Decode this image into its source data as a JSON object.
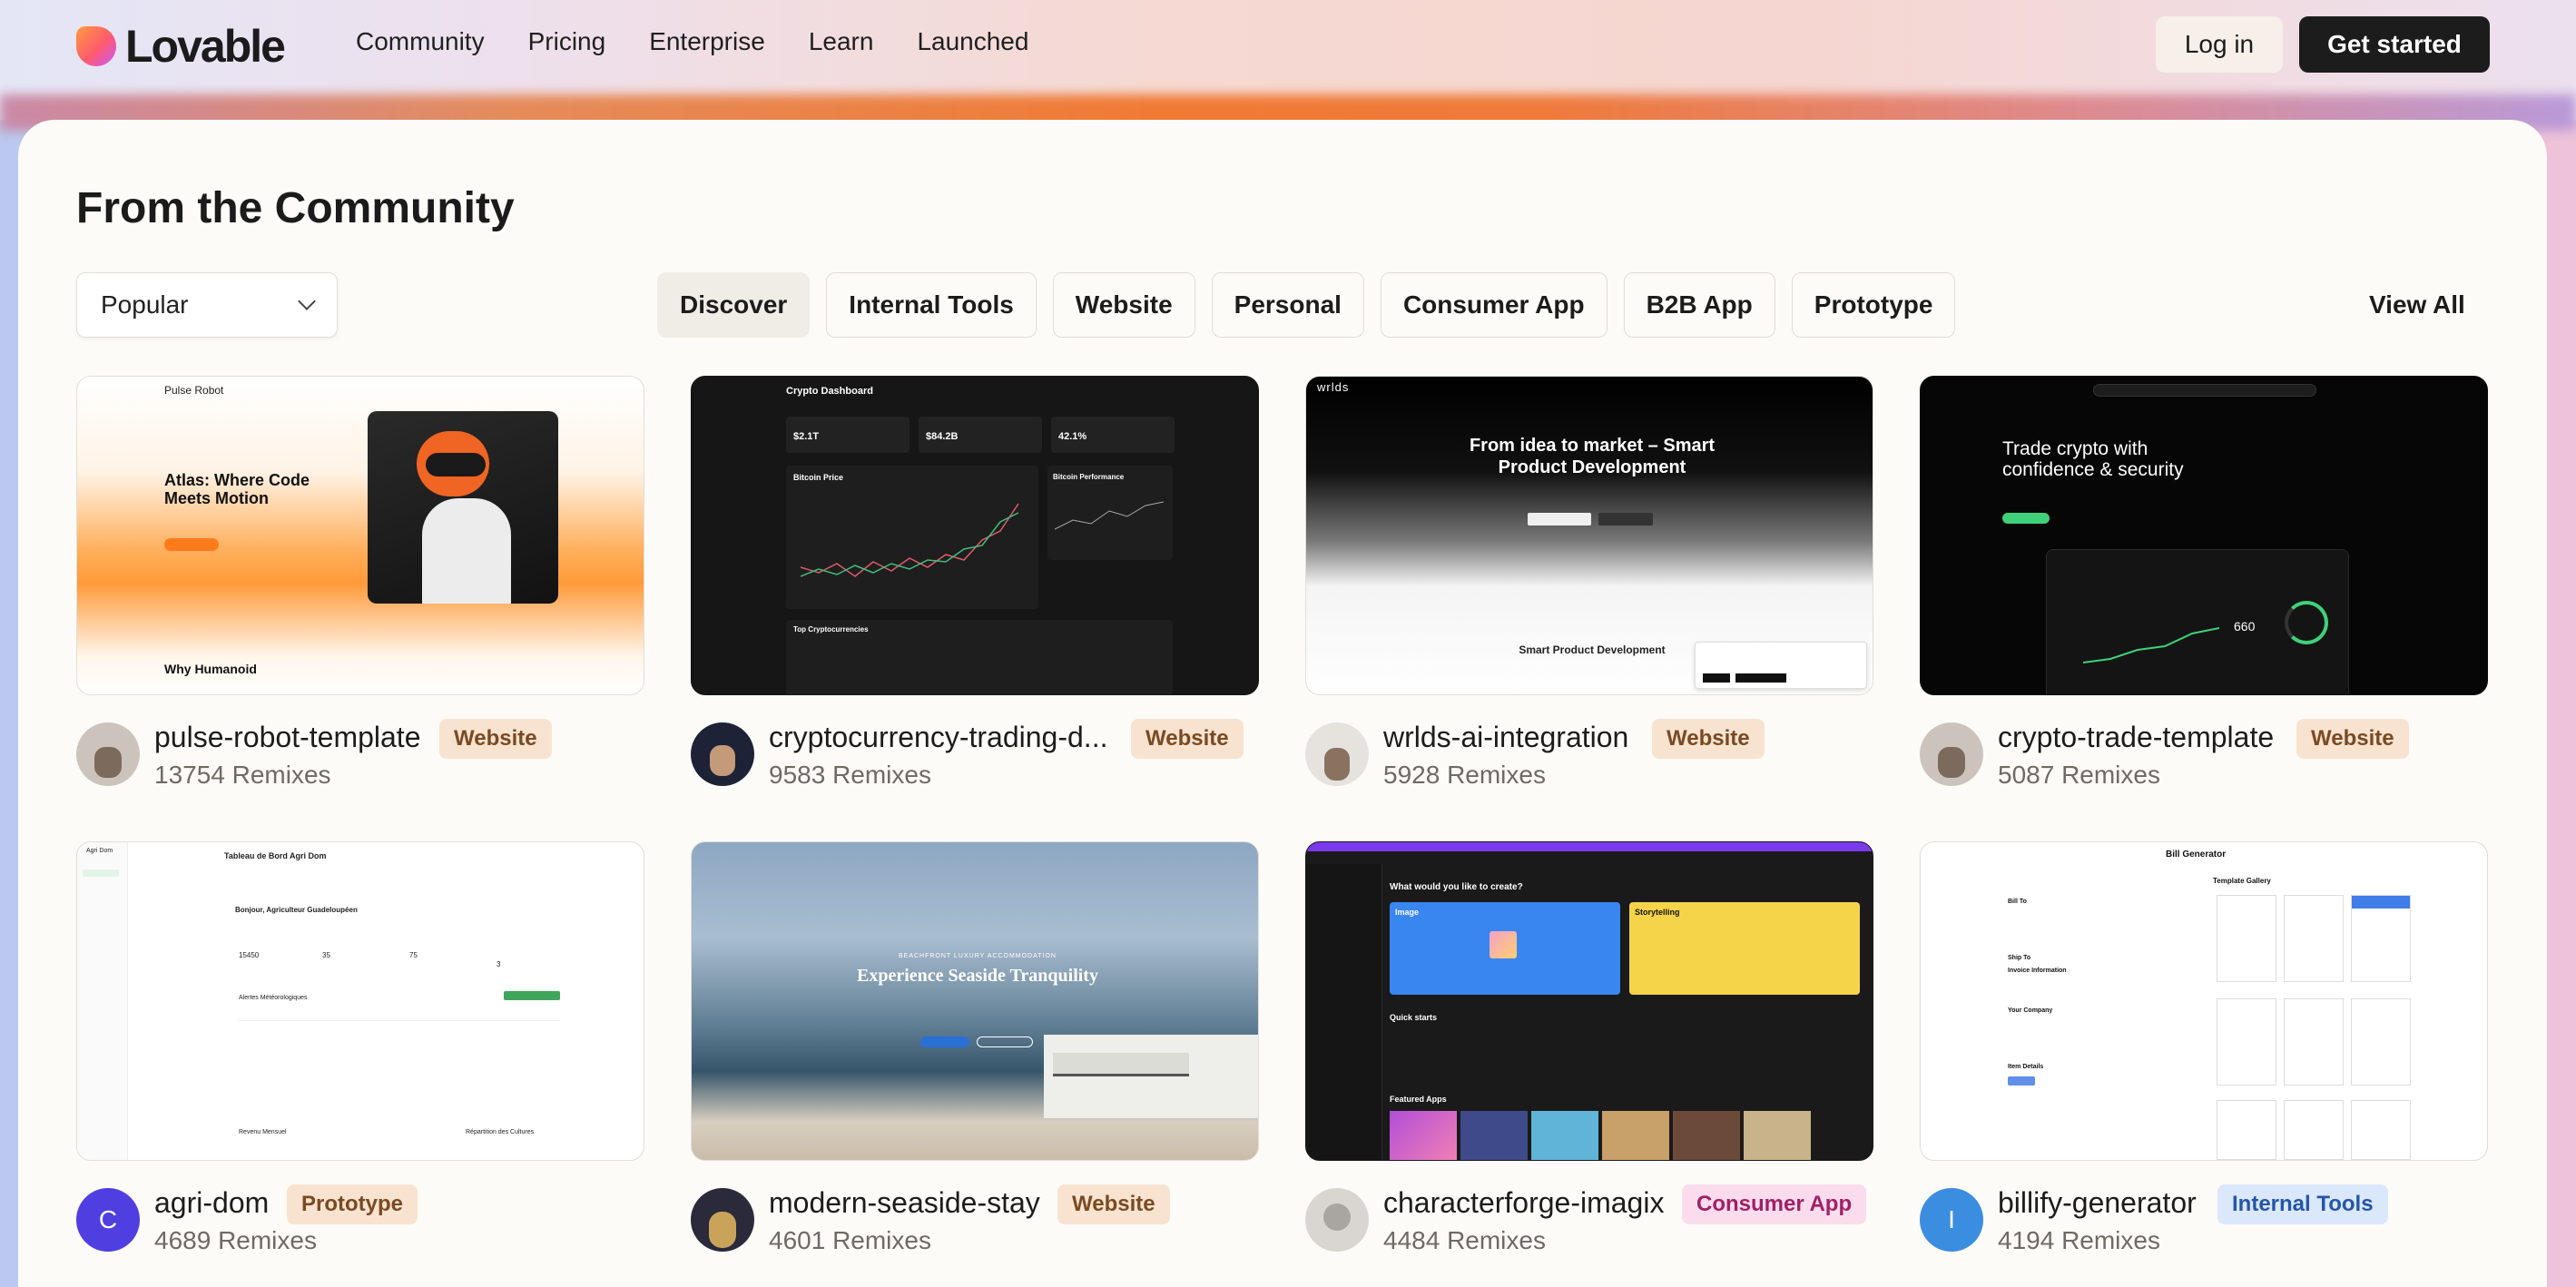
{
  "header": {
    "brand": "Lovable",
    "nav": [
      "Community",
      "Pricing",
      "Enterprise",
      "Learn",
      "Launched"
    ],
    "login_label": "Log in",
    "start_label": "Get started"
  },
  "section": {
    "title": "From the Community",
    "sort_value": "Popular",
    "filters": [
      "Discover",
      "Internal Tools",
      "Website",
      "Personal",
      "Consumer App",
      "B2B App",
      "Prototype"
    ],
    "view_all": "View All"
  },
  "cards": [
    {
      "title": "pulse-robot-template",
      "badge": "Website",
      "remixes": "13754 Remixes",
      "thumb": {
        "brand": "Pulse Robot",
        "headline": "Atlas: Where Code Meets Motion",
        "footer": "Why Humanoid"
      }
    },
    {
      "title": "cryptocurrency-trading-d...",
      "badge": "Website",
      "remixes": "9583 Remixes",
      "thumb": {
        "heading": "Crypto Dashboard",
        "m1": "$2.1T",
        "m2": "$84.2B",
        "m3": "42.1%",
        "p1": "Bitcoin Price",
        "p2": "Bitcoin Performance",
        "table": "Top Cryptocurrencies"
      }
    },
    {
      "title": "wrlds-ai-integration",
      "badge": "Website",
      "remixes": "5928 Remixes",
      "thumb": {
        "brand": "wrlds",
        "headline": "From idea to market – Smart Product Development",
        "sub": "Smart Product Development"
      }
    },
    {
      "title": "crypto-trade-template",
      "badge": "Website",
      "remixes": "5087 Remixes",
      "thumb": {
        "headline": "Trade crypto with confidence & security",
        "value": "660"
      }
    },
    {
      "title": "agri-dom",
      "badge": "Prototype",
      "remixes": "4689 Remixes",
      "avatar_letter": "C",
      "thumb": {
        "brand": "Agri Dom",
        "heading": "Tableau de Bord Agri Dom",
        "greeting": "Bonjour, Agriculteur Guadeloupéen",
        "n1": "15450",
        "n2": "35",
        "n3": "75",
        "n4": "3",
        "alerts": "Alertes Météorologiques",
        "revenue": "Revenu Mensuel",
        "crops": "Répartition des Cultures"
      }
    },
    {
      "title": "modern-seaside-stay",
      "badge": "Website",
      "remixes": "4601 Remixes",
      "thumb": {
        "kicker": "BEACHFRONT LUXURY ACCOMMODATION",
        "headline": "Experience Seaside Tranquility"
      }
    },
    {
      "title": "characterforge-imagix",
      "badge": "Consumer App",
      "remixes": "4484 Remixes",
      "thumb": {
        "question": "What would you like to create?",
        "card1": "Image",
        "card2": "Storytelling",
        "quick": "Quick starts",
        "featured": "Featured Apps"
      }
    },
    {
      "title": "billify-generator",
      "badge": "Internal Tools",
      "remixes": "4194 Remixes",
      "avatar_letter": "I",
      "thumb": {
        "heading": "Bill Generator",
        "gallery": "Template Gallery",
        "bill_to": "Bill To",
        "ship_to": "Ship To",
        "invoice": "Invoice Information",
        "company": "Your Company",
        "items": "Item Details"
      }
    }
  ]
}
